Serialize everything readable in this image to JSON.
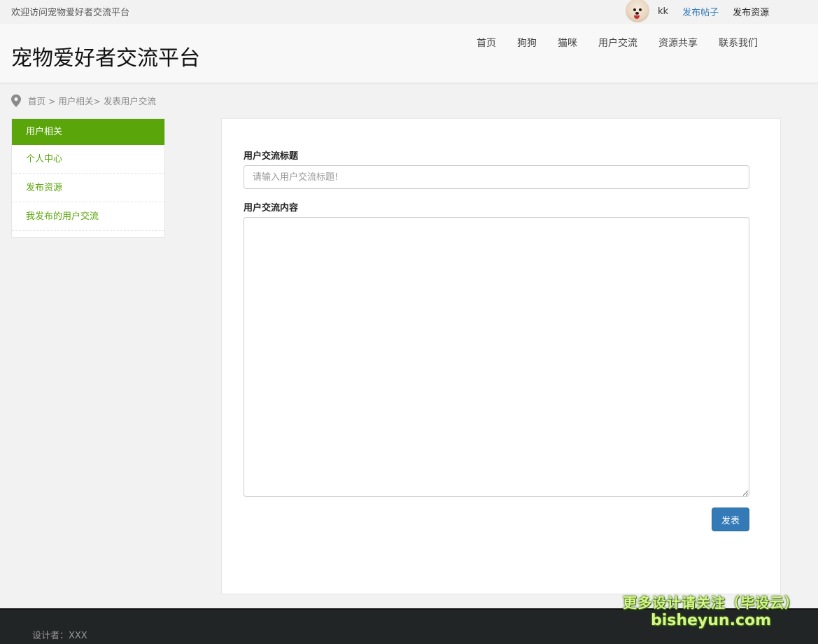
{
  "topbar": {
    "welcome": "欢迎访问宠物爱好者交流平台",
    "username": "kk",
    "post_link": "发布帖子",
    "resource_link": "发布资源"
  },
  "header": {
    "site_title": "宠物爱好者交流平台",
    "nav": [
      "首页",
      "狗狗",
      "猫咪",
      "用户交流",
      "资源共享",
      "联系我们"
    ]
  },
  "breadcrumb": {
    "text": "首页 > 用户相关> 发表用户交流"
  },
  "sidebar": {
    "heading": "用户相关",
    "items": [
      "个人中心",
      "发布资源",
      "我发布的用户交流"
    ]
  },
  "form": {
    "title_label": "用户交流标题",
    "title_placeholder": "请输入用户交流标题!",
    "title_value": "",
    "content_label": "用户交流内容",
    "content_value": "",
    "submit_label": "发表"
  },
  "footer": {
    "designer": "设计者：XXX"
  },
  "watermark": {
    "line1": "更多设计请关注（毕设云）",
    "line2": "bisheyun.com"
  },
  "colors": {
    "accent_green": "#5aa50a",
    "button_blue": "#337ab7",
    "link_blue": "#337ab7",
    "footer_bg": "#222526"
  }
}
